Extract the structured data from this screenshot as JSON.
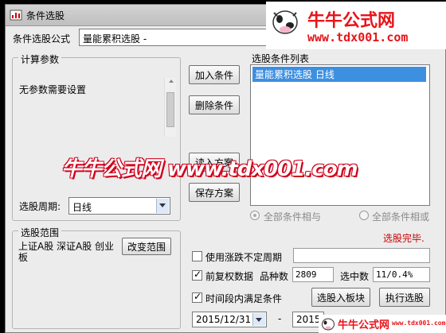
{
  "window": {
    "title": "条件选股"
  },
  "formula": {
    "label": "条件选股公式",
    "value": "量能累积选股 -"
  },
  "params": {
    "group_title": "计算参数",
    "text": "无参数需要设置"
  },
  "period": {
    "label": "选股周期:",
    "value": "日线"
  },
  "buttons": {
    "add": "加入条件",
    "delete": "删除条件",
    "read": "读入方案",
    "save": "保存方案",
    "change_range": "改变范围",
    "to_block": "选股入板块",
    "execute": "执行选股"
  },
  "condition_list": {
    "title": "选股条件列表",
    "items": [
      "量能累积选股  日线"
    ]
  },
  "logic": {
    "and": "全部条件相与",
    "or": "全部条件相或"
  },
  "status": {
    "text": "选股完毕.",
    "color": "#cc0000"
  },
  "range": {
    "group_title": "选股范围",
    "text": "上证A股 深证A股 创业板"
  },
  "options": {
    "variable_period": "使用涨跌不定周期",
    "adjusted": "前复权数据",
    "time_window": "时间段内满足条件"
  },
  "stats": {
    "count_label": "品种数",
    "count_value": "2809",
    "selected_label": "选中数",
    "selected_value": "11/0.4%"
  },
  "dates": {
    "start": "2015/12/31",
    "separator": "-",
    "end": "2015"
  },
  "watermark": {
    "brand": "牛牛公式网",
    "url": "www.tdx001.com",
    "overlay": "牛牛公式网 www.tdx001.com"
  }
}
